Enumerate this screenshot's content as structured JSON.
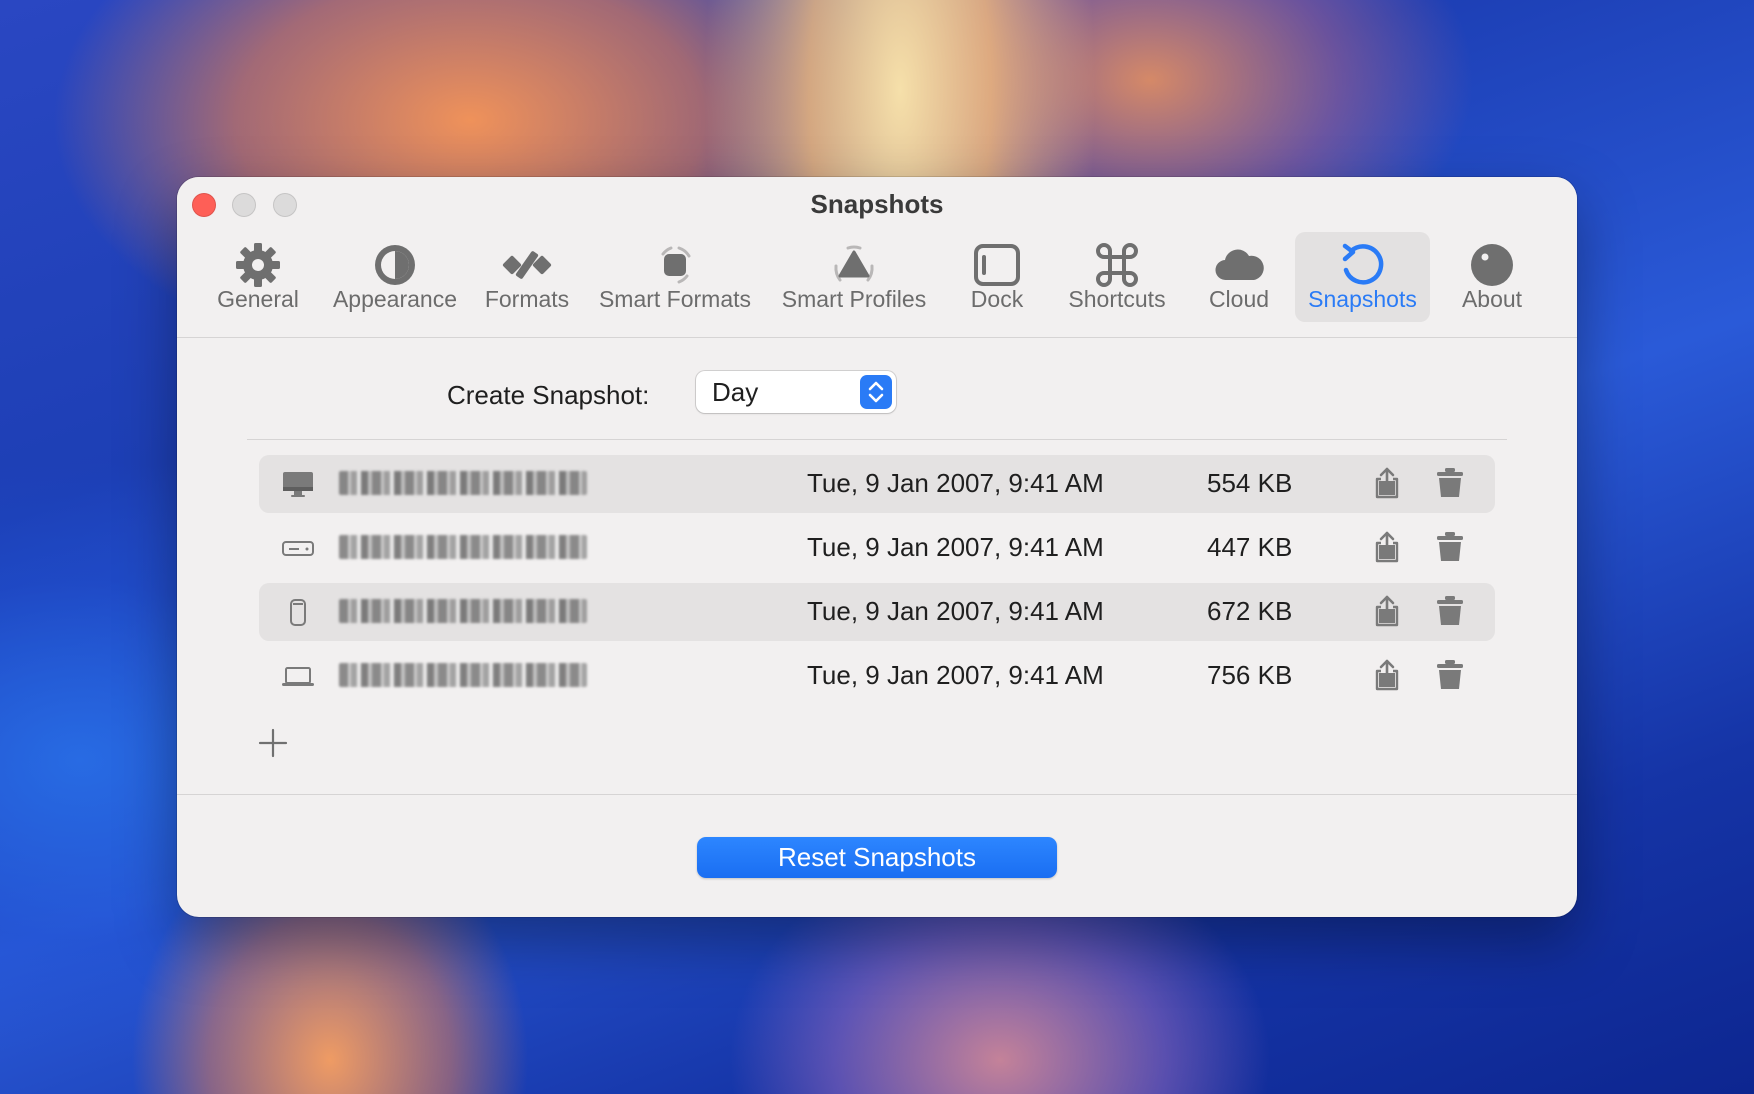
{
  "window": {
    "title": "Snapshots"
  },
  "toolbar": {
    "tabs": [
      {
        "label": "General",
        "icon": "gear-icon"
      },
      {
        "label": "Appearance",
        "icon": "half-circle-icon"
      },
      {
        "label": "Formats",
        "icon": "formats-icon"
      },
      {
        "label": "Smart Formats",
        "icon": "smart-formats-icon"
      },
      {
        "label": "Smart Profiles",
        "icon": "smart-profiles-icon"
      },
      {
        "label": "Dock",
        "icon": "dock-icon"
      },
      {
        "label": "Shortcuts",
        "icon": "command-icon"
      },
      {
        "label": "Cloud",
        "icon": "cloud-icon"
      },
      {
        "label": "Snapshots",
        "icon": "restore-icon",
        "selected": true
      },
      {
        "label": "About",
        "icon": "about-icon"
      }
    ]
  },
  "snapshot_settings": {
    "label": "Create Snapshot:",
    "frequency": "Day"
  },
  "snapshots": [
    {
      "device_icon": "imac-icon",
      "date": "Tue, 9 Jan 2007, 9:41 AM",
      "size": "554 KB"
    },
    {
      "device_icon": "mac-mini-icon",
      "date": "Tue, 9 Jan 2007, 9:41 AM",
      "size": "447 KB"
    },
    {
      "device_icon": "mac-pro-icon",
      "date": "Tue, 9 Jan 2007, 9:41 AM",
      "size": "672 KB"
    },
    {
      "device_icon": "macbook-icon",
      "date": "Tue, 9 Jan 2007, 9:41 AM",
      "size": "756 KB"
    }
  ],
  "footer": {
    "reset_label": "Reset Snapshots"
  },
  "colors": {
    "accent": "#2a7bf6",
    "close": "#fe5f57",
    "window_bg": "#f2f0f0"
  }
}
